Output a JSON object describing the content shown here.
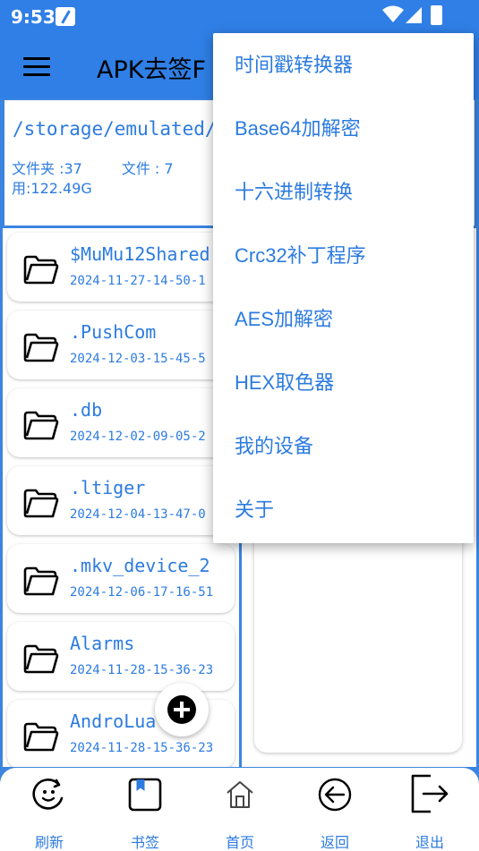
{
  "status": {
    "time": "9:53"
  },
  "appbar": {
    "title": "APK去签F"
  },
  "path": {
    "current": "/storage/emulated/",
    "folders_label": "文件夹 :37",
    "files_label": "文件 : 7",
    "used_label": "用:122.49G"
  },
  "files": [
    {
      "name": "$MuMu12Shared",
      "date": "2024-11-27-14-50-1"
    },
    {
      "name": ".PushCom",
      "date": "2024-12-03-15-45-5"
    },
    {
      "name": ".db",
      "date": "2024-12-02-09-05-2"
    },
    {
      "name": ".ltiger",
      "date": "2024-12-04-13-47-0"
    },
    {
      "name": ".mkv_device_2",
      "date": "2024-12-06-17-16-51"
    },
    {
      "name": "Alarms",
      "date": "2024-11-28-15-36-23"
    },
    {
      "name": "AndroLua",
      "date": "2024-11-28-15-36-23"
    }
  ],
  "menu": {
    "items": [
      "时间戳转换器",
      "Base64加解密",
      "十六进制转换",
      "Crc32补丁程序",
      "AES加解密",
      "HEX取色器",
      "我的设备",
      "关于"
    ]
  },
  "bottom_nav": {
    "items": [
      {
        "label": "刷新",
        "icon": "refresh-smile-icon"
      },
      {
        "label": "书签",
        "icon": "bookmark-icon"
      },
      {
        "label": "首页",
        "icon": "home-icon"
      },
      {
        "label": "返回",
        "icon": "back-arrow-icon"
      },
      {
        "label": "退出",
        "icon": "exit-icon"
      }
    ]
  },
  "colors": {
    "accent": "#2c7be0",
    "appbar": "#2f7fe6",
    "background": "#3b84e0"
  }
}
